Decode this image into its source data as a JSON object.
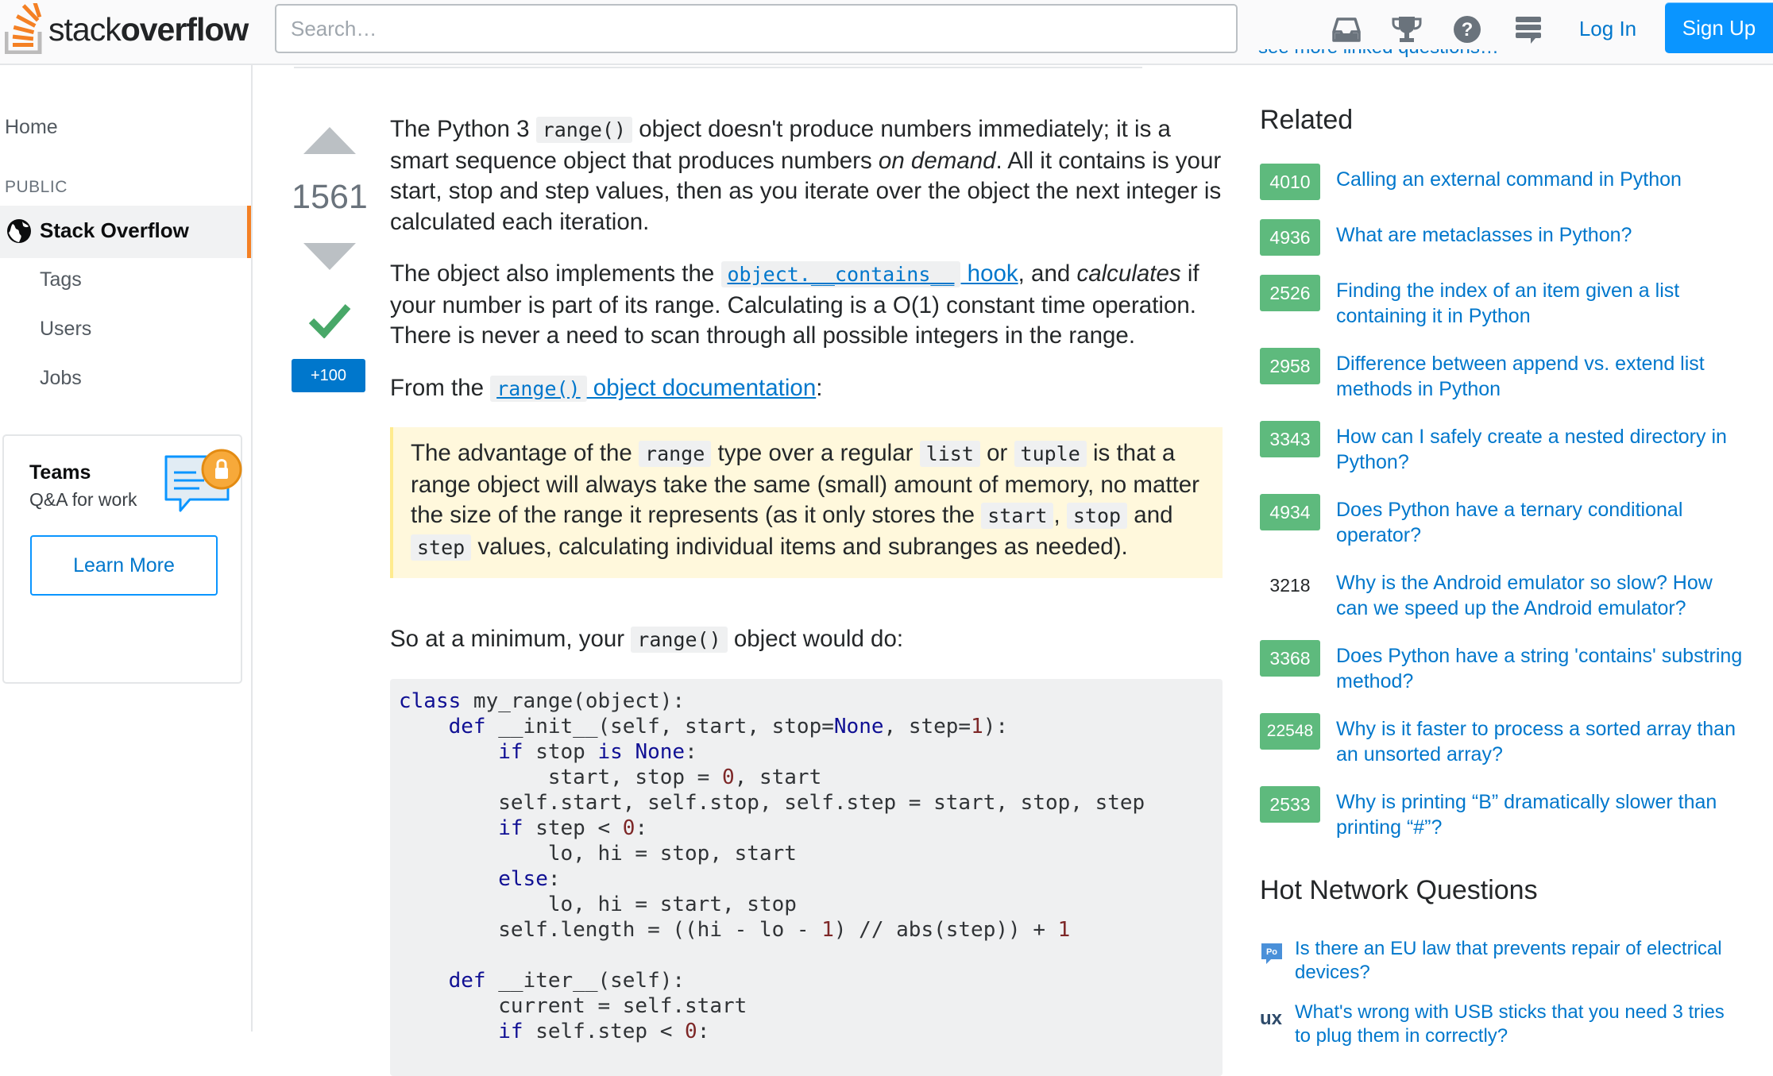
{
  "header": {
    "logo_light": "stack",
    "logo_bold": "overflow",
    "search_placeholder": "Search…",
    "login": "Log In",
    "signup": "Sign Up"
  },
  "sidebar": {
    "home": "Home",
    "public": "PUBLIC",
    "stack_overflow": "Stack Overflow",
    "tags": "Tags",
    "users": "Users",
    "jobs": "Jobs",
    "teams": {
      "title": "Teams",
      "subtitle": "Q&A for work",
      "button": "Learn More"
    }
  },
  "post": {
    "votes": "1561",
    "bounty": "+100",
    "p1": {
      "a": "The Python 3 ",
      "code": "range()",
      "b": " object doesn't produce numbers immediately; it is a smart sequence object that produces numbers ",
      "em": "on demand",
      "c": ". All it contains is your start, stop and step values, then as you iterate over the object the next integer is calculated each iteration."
    },
    "p2": {
      "a": "The object also implements the ",
      "link_code": "object.__contains__",
      "link_text": " hook",
      "b": ", and ",
      "em": "calculates",
      "c": " if your number is part of its range. Calculating is a O(1) constant time operation. There is never a need to scan through all possible integers in the range."
    },
    "p3": {
      "a": "From the ",
      "link_code": "range()",
      "link_text": " object documentation",
      "b": ":"
    },
    "quote": {
      "a": "The advantage of the ",
      "c1": "range",
      "b": " type over a regular ",
      "c2": "list",
      "c": " or ",
      "c3": "tuple",
      "d": " is that a range object will always take the same (small) amount of memory, no matter the size of the range it represents (as it only stores the ",
      "c4": "start",
      "e": ", ",
      "c5": "stop",
      "f": " and ",
      "c6": "step",
      "g": " values, calculating individual items and subranges as needed)."
    },
    "p4": {
      "a": "So at a minimum, your ",
      "code": "range()",
      "b": " object would do:"
    },
    "code_lines": [
      "class my_range(object):",
      "    def __init__(self, start, stop=None, step=1):",
      "        if stop is None:",
      "            start, stop = 0, start",
      "        self.start, self.stop, self.step = start, stop, step",
      "        if step < 0:",
      "            lo, hi = stop, start",
      "        else:",
      "            lo, hi = start, stop",
      "        self.length = ((hi - lo - 1) // abs(step)) + 1",
      "",
      "    def __iter__(self):",
      "        current = self.start",
      "        if self.step < 0:"
    ]
  },
  "right": {
    "see_more": "see more linked questions…",
    "related_title": "Related",
    "related": [
      {
        "score": "4010",
        "accepted": true,
        "title": "Calling an external command in Python"
      },
      {
        "score": "4936",
        "accepted": true,
        "title": "What are metaclasses in Python?"
      },
      {
        "score": "2526",
        "accepted": true,
        "title": "Finding the index of an item given a list containing it in Python"
      },
      {
        "score": "2958",
        "accepted": true,
        "title": "Difference between append vs. extend list methods in Python"
      },
      {
        "score": "3343",
        "accepted": true,
        "title": "How can I safely create a nested directory in Python?"
      },
      {
        "score": "4934",
        "accepted": true,
        "title": "Does Python have a ternary conditional operator?"
      },
      {
        "score": "3218",
        "accepted": false,
        "title": "Why is the Android emulator so slow? How can we speed up the Android emulator?"
      },
      {
        "score": "3368",
        "accepted": true,
        "title": "Does Python have a string 'contains' substring method?"
      },
      {
        "score": "22548",
        "accepted": true,
        "title": "Why is it faster to process a sorted array than an unsorted array?"
      },
      {
        "score": "2533",
        "accepted": true,
        "title": "Why is printing “B” dramatically slower than printing “#”?"
      }
    ],
    "hot_title": "Hot Network Questions",
    "hot": [
      {
        "icon": "politics-site-icon",
        "title": "Is there an EU law that prevents repair of electrical devices?"
      },
      {
        "icon": "ux-site-icon",
        "title": "What's wrong with USB sticks that you need 3 tries to plug them in correctly?"
      }
    ]
  },
  "colors": {
    "accent_orange": "#f48024",
    "link_blue": "#0077cc",
    "signup_blue": "#0a95ff",
    "accepted_green": "#5eba7d",
    "quote_bg": "#fff8dc"
  }
}
